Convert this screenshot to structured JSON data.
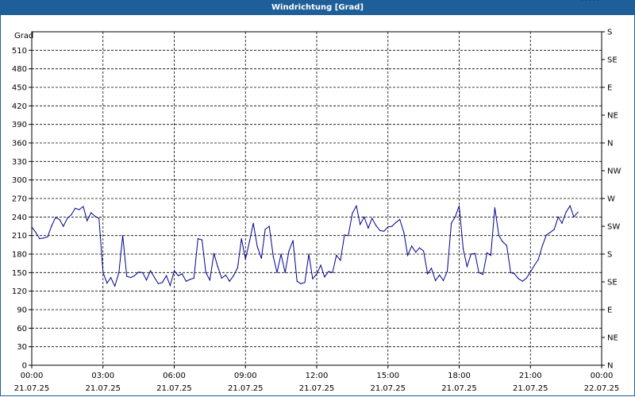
{
  "window": {
    "title": "Windrichtung [Grad]"
  },
  "chart_data": {
    "type": "line",
    "title": "Windrichtung [Grad]",
    "ylabel": "Grad",
    "ylim": [
      0,
      540
    ],
    "xlim": [
      0,
      24
    ],
    "y_ticks": [
      0,
      30,
      60,
      90,
      120,
      150,
      180,
      210,
      240,
      270,
      300,
      330,
      360,
      390,
      420,
      450,
      480,
      510
    ],
    "right_axis_labels": [
      "N",
      "NE",
      "E",
      "SE",
      "S",
      "SW",
      "W",
      "NW",
      "N",
      "NE",
      "E",
      "SE",
      "S"
    ],
    "x_ticks": [
      {
        "hour": 0,
        "time": "00:00",
        "date": "21.07.25"
      },
      {
        "hour": 3,
        "time": "03:00",
        "date": "21.07.25"
      },
      {
        "hour": 6,
        "time": "06:00",
        "date": "21.07.25"
      },
      {
        "hour": 9,
        "time": "09:00",
        "date": "21.07.25"
      },
      {
        "hour": 12,
        "time": "12:00",
        "date": "21.07.25"
      },
      {
        "hour": 15,
        "time": "15:00",
        "date": "21.07.25"
      },
      {
        "hour": 18,
        "time": "18:00",
        "date": "21.07.25"
      },
      {
        "hour": 21,
        "time": "21:00",
        "date": "21.07.25"
      },
      {
        "hour": 24,
        "time": "00:00",
        "date": "22.07.25"
      }
    ],
    "grid": true,
    "line_color": "#00008b",
    "x_hours": [
      0,
      0.17,
      0.33,
      0.5,
      0.67,
      0.83,
      1,
      1.17,
      1.33,
      1.5,
      1.67,
      1.83,
      2,
      2.17,
      2.33,
      2.5,
      2.67,
      2.83,
      3,
      3.17,
      3.33,
      3.5,
      3.67,
      3.83,
      4,
      4.17,
      4.33,
      4.5,
      4.67,
      4.83,
      5,
      5.17,
      5.33,
      5.5,
      5.67,
      5.83,
      6,
      6.17,
      6.33,
      6.5,
      6.67,
      6.83,
      7,
      7.17,
      7.33,
      7.5,
      7.67,
      7.83,
      8,
      8.17,
      8.33,
      8.5,
      8.67,
      8.83,
      9,
      9.17,
      9.33,
      9.5,
      9.67,
      9.83,
      10,
      10.17,
      10.33,
      10.5,
      10.67,
      10.83,
      11,
      11.17,
      11.33,
      11.5,
      11.67,
      11.83,
      12,
      12.17,
      12.33,
      12.5,
      12.67,
      12.83,
      13,
      13.17,
      13.33,
      13.5,
      13.67,
      13.83,
      14,
      14.17,
      14.33,
      14.5,
      14.67,
      14.83,
      15,
      15.17,
      15.33,
      15.5,
      15.67,
      15.83,
      16,
      16.17,
      16.33,
      16.5,
      16.67,
      16.83,
      17,
      17.17,
      17.33,
      17.5,
      17.67,
      17.83,
      18,
      18.17,
      18.33,
      18.5,
      18.67,
      18.83,
      19,
      19.17,
      19.33,
      19.5,
      19.67,
      19.83,
      20,
      20.17,
      20.33,
      20.5,
      20.67,
      20.83,
      21,
      21.17,
      21.33,
      21.5,
      21.67,
      21.83,
      22,
      22.17,
      22.33,
      22.5,
      22.67,
      22.83,
      23,
      23.17,
      23.33,
      23.5,
      23.67,
      23.83
    ],
    "values": [
      224,
      215,
      205,
      206,
      208,
      225,
      239,
      236,
      225,
      238,
      244,
      254,
      252,
      257,
      234,
      247,
      241,
      238,
      150,
      133,
      142,
      128,
      150,
      210,
      144,
      142,
      145,
      151,
      150,
      138,
      153,
      142,
      132,
      134,
      145,
      129,
      153,
      145,
      148,
      136,
      139,
      141,
      205,
      203,
      150,
      138,
      181,
      160,
      141,
      146,
      136,
      145,
      158,
      205,
      172,
      200,
      230,
      192,
      173,
      220,
      225,
      176,
      150,
      180,
      150,
      185,
      202,
      136,
      132,
      134,
      180,
      140,
      148,
      162,
      143,
      152,
      150,
      178,
      170,
      211,
      210,
      246,
      258,
      228,
      240,
      222,
      238,
      226,
      218,
      217,
      224,
      225,
      231,
      236,
      215,
      178,
      193,
      183,
      190,
      185,
      148,
      157,
      137,
      146,
      137,
      152,
      230,
      240,
      258,
      188,
      160,
      180,
      181,
      150,
      147,
      182,
      178,
      255,
      210,
      200,
      194,
      150,
      148,
      140,
      136,
      141,
      151,
      162,
      171,
      193,
      211,
      215,
      220,
      240,
      230,
      248,
      258,
      240,
      248
    ]
  }
}
